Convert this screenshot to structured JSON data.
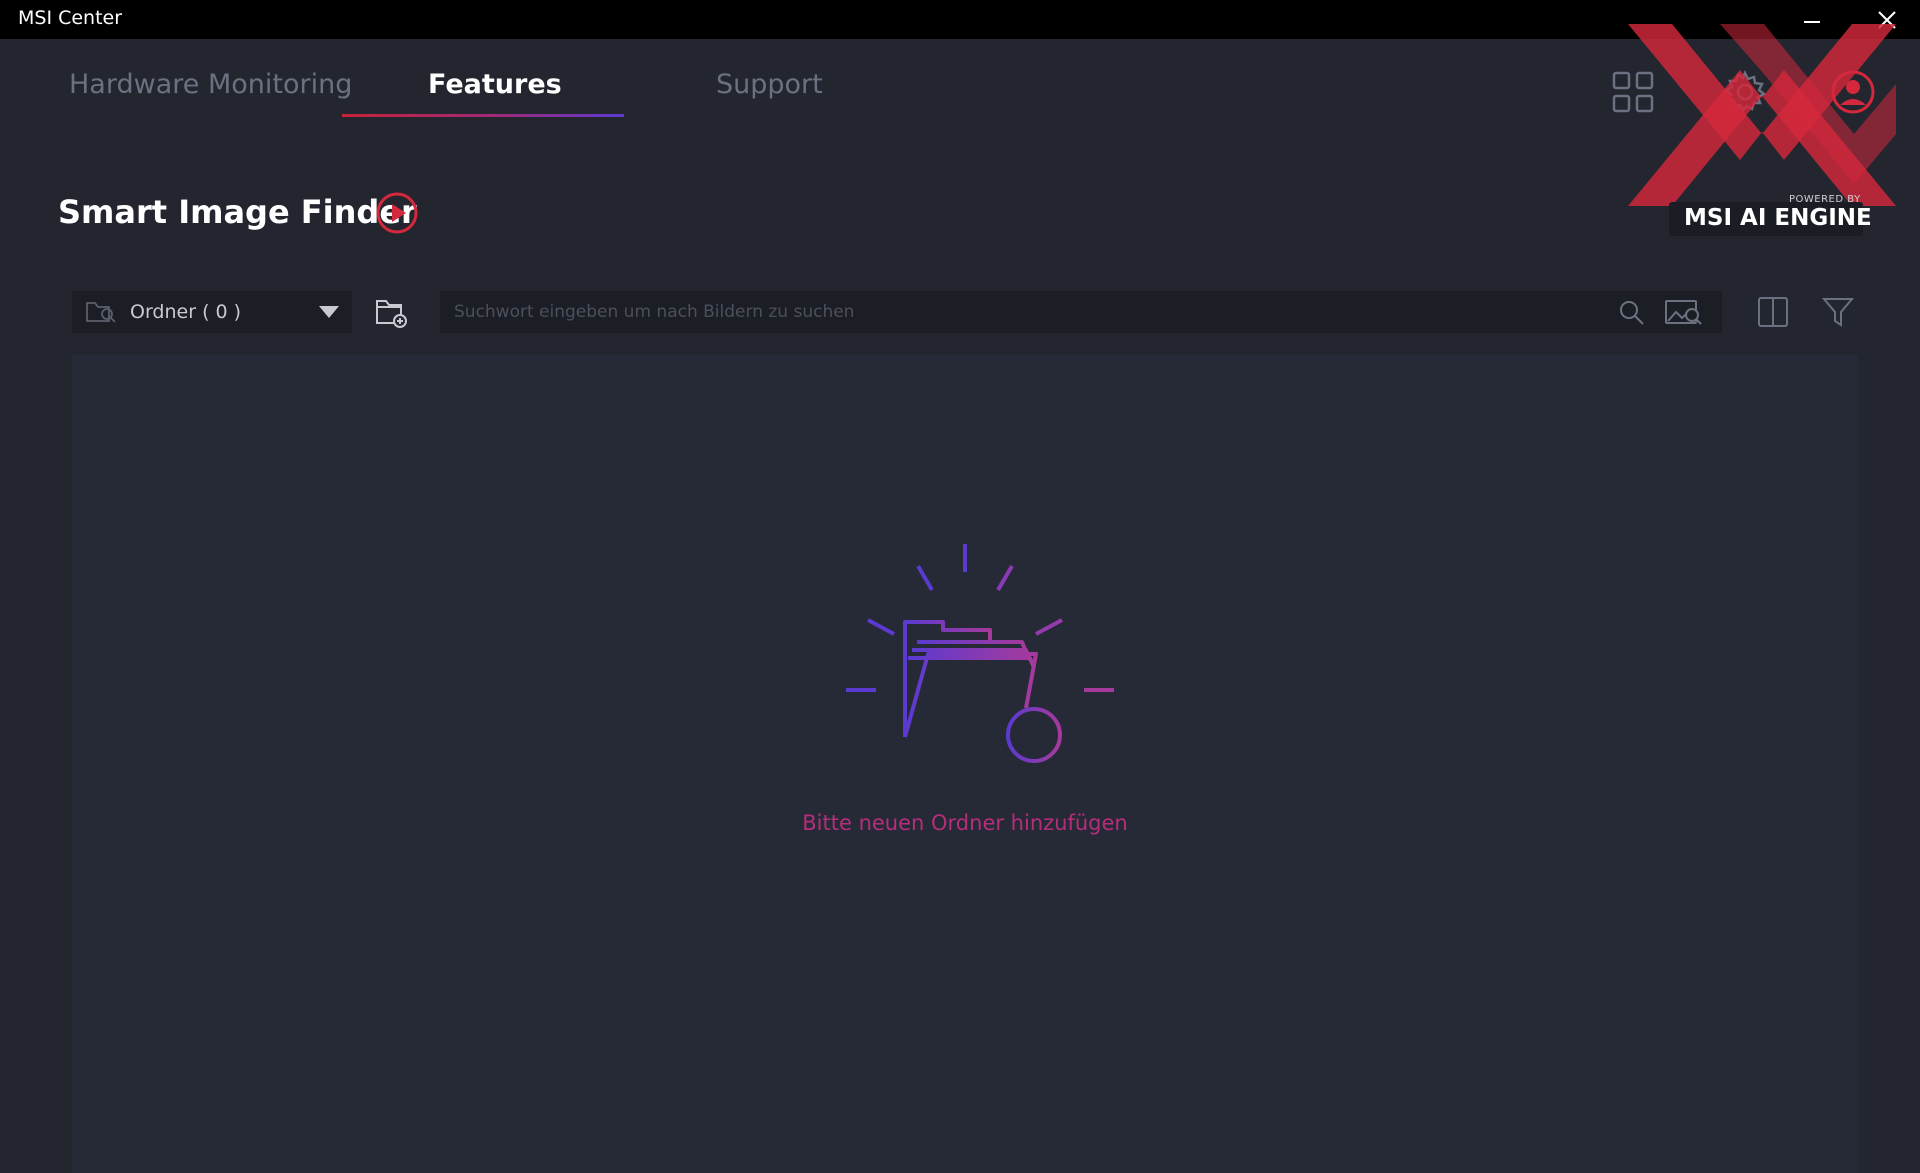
{
  "window": {
    "title": "MSI Center"
  },
  "tabs": [
    {
      "label": "Hardware Monitoring",
      "active": false
    },
    {
      "label": "Features",
      "active": true
    },
    {
      "label": "Support",
      "active": false
    }
  ],
  "branding": {
    "powered_by": "POWERED BY",
    "engine": "MSI AI ENGINE",
    "accent_color": "#d4283c"
  },
  "page": {
    "title": "Smart Image Finder"
  },
  "toolbar": {
    "folder_select_label": "Ordner ( 0 )",
    "search_placeholder": "Suchwort eingeben um nach Bildern zu suchen",
    "search_value": ""
  },
  "empty_state": {
    "message": "Bitte neuen Ordner hinzufügen",
    "message_color": "#b52e7c"
  },
  "icons": {
    "window": [
      "minimize-icon",
      "close-icon"
    ],
    "header": [
      "grid-icon",
      "gear-icon",
      "user-icon"
    ],
    "toolbar": [
      "folder-search-icon",
      "chevron-down-icon",
      "add-folder-icon",
      "search-icon",
      "image-search-icon",
      "split-view-icon",
      "filter-icon"
    ],
    "page": [
      "play-icon"
    ]
  }
}
